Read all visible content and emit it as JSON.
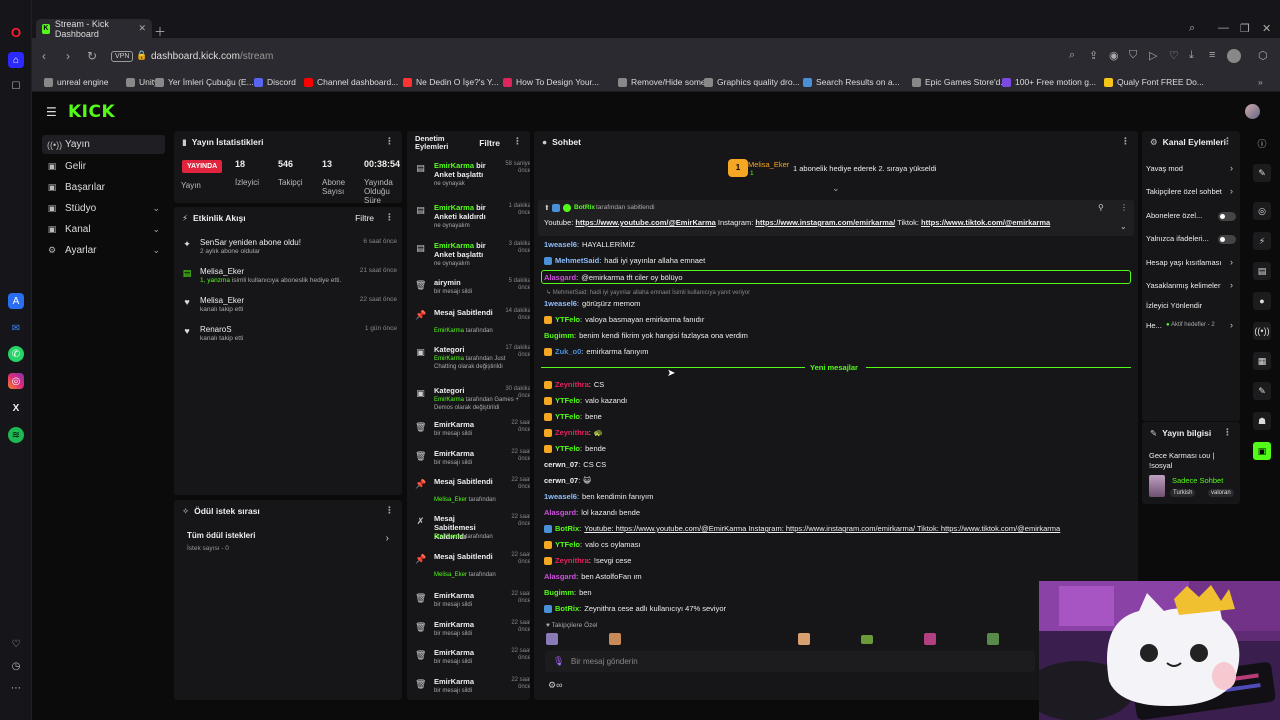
{
  "browser": {
    "tab_title": "Stream - Kick Dashboard",
    "url_domain": "dashboard.kick.com",
    "url_path": "/stream",
    "vpn_label": "VPN",
    "bookmarks": [
      {
        "label": "unreal engine",
        "color": "#888888"
      },
      {
        "label": "Unity",
        "color": "#888888"
      },
      {
        "label": "Yer İmleri Çubuğu (E...",
        "color": "#888888"
      },
      {
        "label": "Discord",
        "color": "#5865f2"
      },
      {
        "label": "Channel dashboard...",
        "color": "#ff0000"
      },
      {
        "label": "Ne Dedin O İşe?'s Y...",
        "color": "#ff3333"
      },
      {
        "label": "How To Design Your...",
        "color": "#e0245e"
      },
      {
        "label": "Remove/Hide some...",
        "color": "#888888"
      },
      {
        "label": "Graphics quality dro...",
        "color": "#888888"
      },
      {
        "label": "Search Results on a...",
        "color": "#4a90d9"
      },
      {
        "label": "Epic Games Store'd...",
        "color": "#888888"
      },
      {
        "label": "100+ Free motion g...",
        "color": "#7b4ae2"
      },
      {
        "label": "Qualy Font FREE Do...",
        "color": "#f5c518"
      }
    ]
  },
  "kick": {
    "logo": "KICK",
    "nav": [
      {
        "label": "Yayın",
        "icon": "broadcast-icon",
        "glyph": "((•))",
        "chevron": false
      },
      {
        "label": "Gelir",
        "icon": "money-icon",
        "glyph": "▣",
        "chevron": false
      },
      {
        "label": "Başarılar",
        "icon": "trophy-icon",
        "glyph": "▣",
        "chevron": false
      },
      {
        "label": "Stüdyo",
        "icon": "studio-icon",
        "glyph": "▣",
        "chevron": true
      },
      {
        "label": "Kanal",
        "icon": "channel-icon",
        "glyph": "▣",
        "chevron": true
      },
      {
        "label": "Ayarlar",
        "icon": "settings-icon",
        "glyph": "⚙",
        "chevron": true
      }
    ]
  },
  "stats": {
    "title": "Yayın İstatistikleri",
    "live_badge": "YAYINDA",
    "live_label": "Yayın",
    "items": [
      {
        "value": "18",
        "label": "İzleyici"
      },
      {
        "value": "546",
        "label": "Takipçi"
      },
      {
        "value": "13",
        "label": "Abone\nSayısı"
      },
      {
        "value": "00:38:54",
        "label": "Yayında\nOlduğu\nSüre"
      }
    ]
  },
  "activity": {
    "title": "Etkinlik Akışı",
    "filter": "Filtre",
    "items": [
      {
        "title": "SenSar yeniden abone oldu!",
        "sub_pre": "",
        "sub_green": "",
        "sub": "2 aylık abone oldular",
        "time": "6 saat önce",
        "icon": "star-icon",
        "glyph": "✦"
      },
      {
        "title": "Melisa_Eker",
        "sub_pre": "",
        "sub_green": "1, yanzma",
        "sub": " isimli kullanıcıya aboneslik hediye etti.",
        "time": "21 saat önce",
        "icon": "gift-icon",
        "glyph": "▤"
      },
      {
        "title": "Melisa_Eker",
        "sub_pre": "",
        "sub_green": "",
        "sub": "kanalı takip etti",
        "time": "22 saat önce",
        "icon": "heart-icon",
        "glyph": "♥"
      },
      {
        "title": "RenaroS",
        "sub_pre": "",
        "sub_green": "",
        "sub": "kanalı takip etti",
        "time": "1 gün önce",
        "icon": "heart-icon",
        "glyph": "♥"
      }
    ]
  },
  "rewards": {
    "title": "Ödül istek sırası",
    "all_label": "Tüm ödül istekleri",
    "sub": "İstek sayısı - 0"
  },
  "moderation": {
    "title": "Denetim\nEylemleri",
    "filter": "Filtre",
    "items": [
      {
        "title_green": "EmirKarma",
        "title": " bir Anket başlattı",
        "sub_green": "",
        "sub": "ne oynayak",
        "time": "58 saniye önce",
        "icon": "poll-icon",
        "glyph": "▤"
      },
      {
        "title_green": "EmirKarma",
        "title": " bir Anketi kaldırdı",
        "sub_green": "",
        "sub": "ne oynayalım",
        "time": "1 dakika önce",
        "icon": "poll-icon",
        "glyph": "▤"
      },
      {
        "title_green": "EmirKarma",
        "title": " bir Anket başlattı",
        "sub_green": "",
        "sub": "ne oynayalım",
        "time": "3 dakika önce",
        "icon": "poll-icon",
        "glyph": "▤"
      },
      {
        "title_green": "",
        "title": "airymin",
        "sub_green": "",
        "sub": "bir mesajı sildi",
        "time": "5 dakika önce",
        "icon": "trash-icon",
        "glyph": "🗑"
      },
      {
        "title_green": "",
        "title": "Mesaj Sabitlendi",
        "sub_green": "EmirKarma",
        "sub": " tarafından",
        "time": "14 dakika önce",
        "icon": "pin-icon",
        "glyph": "📌"
      },
      {
        "title_green": "",
        "title": "Kategori",
        "sub_green": "EmirKarma",
        "sub": " tarafından Just Chatting olarak değiştirildi",
        "time": "17 dakika önce",
        "icon": "category-icon",
        "glyph": "▣"
      },
      {
        "title_green": "",
        "title": "Kategori",
        "sub_green": "EmirKarma",
        "sub": " tarafından Games + Demos olarak değiştirildi",
        "time": "30 dakika önce",
        "icon": "category-icon",
        "glyph": "▣"
      },
      {
        "title_green": "",
        "title": "EmirKarma",
        "sub_green": "",
        "sub": "bir mesajı sildi",
        "time": "22 saat önce",
        "icon": "trash-icon",
        "glyph": "🗑"
      },
      {
        "title_green": "",
        "title": "EmirKarma",
        "sub_green": "",
        "sub": "bir mesajı sildi",
        "time": "22 saat önce",
        "icon": "trash-icon",
        "glyph": "🗑"
      },
      {
        "title_green": "",
        "title": "Mesaj Sabitlendi",
        "sub_green": "Melisa_Eker",
        "sub": " tarafından",
        "time": "22 saat önce",
        "icon": "pin-icon",
        "glyph": "📌"
      },
      {
        "title_green": "",
        "title": "Mesaj Sabitlemesi Kaldırıldı",
        "sub_green": "EmirKarma",
        "sub": " tarafından",
        "time": "22 saat önce",
        "icon": "unpin-icon",
        "glyph": "✗"
      },
      {
        "title_green": "",
        "title": "Mesaj Sabitlendi",
        "sub_green": "Melisa_Eker",
        "sub": " tarafından",
        "time": "22 saat önce",
        "icon": "pin-icon",
        "glyph": "📌"
      },
      {
        "title_green": "",
        "title": "EmirKarma",
        "sub_green": "",
        "sub": "bir mesajı sildi",
        "time": "22 saat önce",
        "icon": "trash-icon",
        "glyph": "🗑"
      },
      {
        "title_green": "",
        "title": "EmirKarma",
        "sub_green": "",
        "sub": "bir mesajı sildi",
        "time": "22 saat önce",
        "icon": "trash-icon",
        "glyph": "🗑"
      },
      {
        "title_green": "",
        "title": "EmirKarma",
        "sub_green": "",
        "sub": "bir mesajı sildi",
        "time": "22 saat önce",
        "icon": "trash-icon",
        "glyph": "🗑"
      },
      {
        "title_green": "",
        "title": "EmirKarma",
        "sub_green": "",
        "sub": "bir mesajı sildi",
        "time": "22 saat önce",
        "icon": "trash-icon",
        "glyph": "🗑"
      }
    ]
  },
  "chat": {
    "title": "Sohbet",
    "gift_user": "Melisa_Eker",
    "gift_count": "1",
    "gift_text": "1 abonelik hediye ederek 2. sıraya yükseldi",
    "pinned_by": "BotRix",
    "pinned_by_suffix": " tarafından sabitlendi",
    "pinned_prefix": "Youtube: ",
    "pinned_yt": "https://www.youtube.com/@EmirKarma",
    "pinned_ig_label": " Instagram: ",
    "pinned_ig": "https://www.instagram.com/emirkarma/",
    "pinned_tt_label": " Tiktok: ",
    "pinned_tt": "https://www.tiktok.com/@emirkarma",
    "reply_to": "MehmetSaid: hadi iyi yayınlar allaha emnaet İsimli kullanıcıya yanıt veriyor",
    "new_messages": "Yeni mesajlar",
    "followers_only": "Takipçilere Özel",
    "input_placeholder": "Bir mesaj gönderin",
    "messages": [
      {
        "user": "1weasel6",
        "color": "#8fbfff",
        "text": "HAYALLERİMİZ",
        "badge": ""
      },
      {
        "user": "MehmetSaid",
        "color": "#8fbfff",
        "text": "hadi iyi yayınlar allaha emnaet",
        "badge": "#4a90d9"
      },
      {
        "user": "Alasgard",
        "color": "#d04fe0",
        "text": "@emirkarma tft ciler oy bölüyo",
        "badge": ""
      },
      {
        "user": "1weasel6",
        "color": "#8fbfff",
        "text": "görüşürz memom",
        "badge": ""
      },
      {
        "user": "YTFelo",
        "color": "#53fc18",
        "text": "valoya basmayan emirkarma fanıdır",
        "badge": "#f5a623"
      },
      {
        "user": "Bugimm",
        "color": "#53fc18",
        "text": "benim kendi fikrim yok hangisi fazlaysa ona verdim",
        "badge": ""
      },
      {
        "user": "Zuk_o0",
        "color": "#4a90d9",
        "text": "emirkarma fanıyım",
        "badge": "#f5a623"
      },
      {
        "user": "Zeynithra",
        "color": "#e0245e",
        "text": "CS",
        "badge": "#f5a623"
      },
      {
        "user": "YTFelo",
        "color": "#53fc18",
        "text": "valo kazandı",
        "badge": "#f5a623"
      },
      {
        "user": "YTFelo",
        "color": "#53fc18",
        "text": "bene",
        "badge": "#f5a623"
      },
      {
        "user": "Zeynithra",
        "color": "#e0245e",
        "text": "🐢",
        "badge": "#f5a623"
      },
      {
        "user": "YTFelo",
        "color": "#53fc18",
        "text": "bende",
        "badge": "#f5a623"
      },
      {
        "user": "cerwn_07",
        "color": "#eeeeee",
        "text": "CS CS",
        "badge": ""
      },
      {
        "user": "cerwn_07",
        "color": "#eeeeee",
        "text": "😺",
        "badge": ""
      },
      {
        "user": "1weasel6",
        "color": "#8fbfff",
        "text": "ben kendimin fanıyım",
        "badge": ""
      },
      {
        "user": "Alasgard",
        "color": "#d04fe0",
        "text": "lol kazandı bende",
        "badge": ""
      },
      {
        "user": "BotRix",
        "color": "#53fc18",
        "text": "Youtube: https://www.youtube.com/@EmirKarma Instagram: https://www.instagram.com/emirkarma/ Tiktok: https://www.tiktok.com/@emirkarma",
        "badge": "#4a90d9"
      },
      {
        "user": "YTFelo",
        "color": "#53fc18",
        "text": "valo cs oylaması",
        "badge": "#f5a623"
      },
      {
        "user": "Zeynithra",
        "color": "#e0245e",
        "text": "!sevgi cese",
        "badge": "#f5a623"
      },
      {
        "user": "Alasgard",
        "color": "#d04fe0",
        "text": "ben AstolfoFan ım",
        "badge": ""
      },
      {
        "user": "Bugimm",
        "color": "#53fc18",
        "text": "ben",
        "badge": ""
      },
      {
        "user": "BotRix",
        "color": "#53fc18",
        "text": "Zeynithra cese adlı kullanıcıyı 47% seviyor",
        "badge": "#4a90d9"
      }
    ]
  },
  "channel_actions": {
    "title": "Kanal Eylemleri",
    "items": [
      {
        "label": "Yavaş mod",
        "control": "chevron"
      },
      {
        "label": "Takipçilere özel sohbet",
        "control": "chevron"
      },
      {
        "label": "Abonelere özel...",
        "control": "toggle"
      },
      {
        "label": "Yalnızca ifadeleri...",
        "control": "toggle"
      },
      {
        "label": "Hesap yaşı kısıtlaması",
        "control": "chevron"
      },
      {
        "label": "Yasaklanmış kelimeler",
        "control": "chevron"
      },
      {
        "label": "İzleyici Yönlendir",
        "control": "none"
      },
      {
        "label": "He...",
        "control": "chevron",
        "extra": "Aktif hedefler - 2"
      }
    ]
  },
  "stream_info": {
    "title": "Yayın bilgisi",
    "stream_title": "Gece Karması ʟᴏᴜ | !sosyal",
    "category": "Sadece Sohbet",
    "tags": [
      "Turkish",
      "valoran"
    ]
  }
}
